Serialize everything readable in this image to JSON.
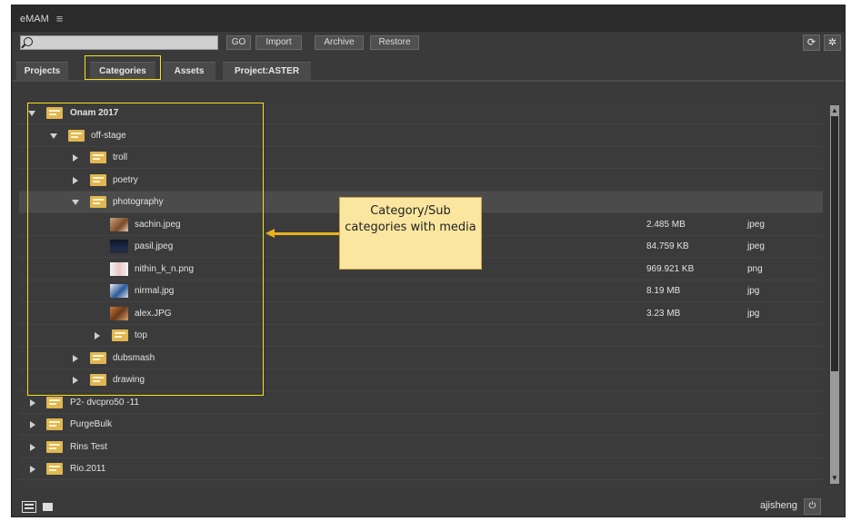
{
  "app": {
    "title": "eMAM",
    "menu_icon": "hamburger-menu-icon"
  },
  "toolbar": {
    "search_placeholder": "",
    "buttons": {
      "go": "GO",
      "import": "Import",
      "archive": "Archive",
      "restore": "Restore"
    },
    "refresh_icon": "refresh-icon",
    "settings_icon": "gear-icon"
  },
  "tabs": [
    {
      "label": "Projects"
    },
    {
      "label": "Categories",
      "highlighted": true
    },
    {
      "label": "Assets"
    },
    {
      "label": "Project:ASTER"
    }
  ],
  "tree": {
    "rows": [
      {
        "label": "Onam 2017",
        "type": "category",
        "expanded": true,
        "bold": true
      },
      {
        "label": "off-stage",
        "type": "category",
        "expanded": true
      },
      {
        "label": "troll",
        "type": "category",
        "expanded": false
      },
      {
        "label": "poetry",
        "type": "category",
        "expanded": false
      },
      {
        "label": "photography",
        "type": "category",
        "expanded": true,
        "selected": true
      },
      {
        "label": "sachin.jpeg",
        "type": "file",
        "size": "2.485 MB",
        "format": "jpeg"
      },
      {
        "label": "pasil.jpeg",
        "type": "file",
        "size": "84.759 KB",
        "format": "jpeg"
      },
      {
        "label": "nithin_k_n.png",
        "type": "file",
        "size": "969.921 KB",
        "format": "png"
      },
      {
        "label": "nirmal.jpg",
        "type": "file",
        "size": "8.19 MB",
        "format": "jpg"
      },
      {
        "label": "alex.JPG",
        "type": "file",
        "size": "3.23 MB",
        "format": "jpg"
      },
      {
        "label": "top",
        "type": "category",
        "expanded": false
      },
      {
        "label": "dubsmash",
        "type": "category",
        "expanded": false
      },
      {
        "label": "drawing",
        "type": "category",
        "expanded": false
      },
      {
        "label": "P2- dvcpro50 -11",
        "type": "category",
        "expanded": false
      },
      {
        "label": "PurgeBulk",
        "type": "category",
        "expanded": false
      },
      {
        "label": "Rins Test",
        "type": "category",
        "expanded": false
      },
      {
        "label": "Rio.2011",
        "type": "category",
        "expanded": false
      }
    ]
  },
  "annotation": {
    "callout_text": "Category/Sub categories with media",
    "color": "#f2e01c"
  },
  "footer": {
    "username": "ajisheng",
    "list_view_icon": "list-view-icon",
    "grid_view_icon": "grid-view-icon",
    "power_icon": "power-icon"
  },
  "colors": {
    "background": "#3a3a3a",
    "folder": "#e0b752",
    "highlight": "#f2e01c",
    "callout_bg": "#fbe6a0"
  }
}
